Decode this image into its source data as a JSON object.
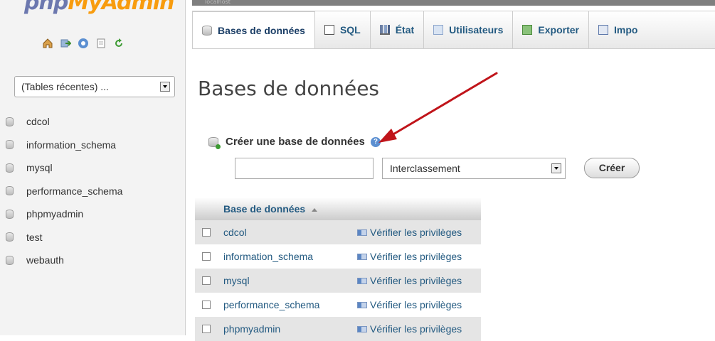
{
  "app": {
    "logo_part1": "php",
    "logo_part2": "MyAdmin"
  },
  "sidebar": {
    "quick_icons": [
      "home-icon",
      "exit-icon",
      "help-icon",
      "docs-icon",
      "reload-icon"
    ],
    "recent_tables_select": "(Tables récentes) ...",
    "databases": [
      "cdcol",
      "information_schema",
      "mysql",
      "performance_schema",
      "phpmyadmin",
      "test",
      "webauth"
    ]
  },
  "topbar": {
    "breadcrumb": "localhost"
  },
  "tabs": [
    {
      "label": "Bases de données",
      "icon": "database-icon",
      "active": true
    },
    {
      "label": "SQL",
      "icon": "sql-icon"
    },
    {
      "label": "État",
      "icon": "status-icon"
    },
    {
      "label": "Utilisateurs",
      "icon": "users-icon"
    },
    {
      "label": "Exporter",
      "icon": "export-icon"
    },
    {
      "label": "Impo",
      "icon": "import-icon"
    }
  ],
  "main": {
    "title": "Bases de données",
    "create_label": "Créer une base de données",
    "create_input_value": "",
    "collation_selected": "Interclassement",
    "create_button": "Créer",
    "table": {
      "header": "Base de données",
      "rows": [
        {
          "name": "cdcol",
          "action": "Vérifier les privilèges"
        },
        {
          "name": "information_schema",
          "action": "Vérifier les privilèges"
        },
        {
          "name": "mysql",
          "action": "Vérifier les privilèges"
        },
        {
          "name": "performance_schema",
          "action": "Vérifier les privilèges"
        },
        {
          "name": "phpmyadmin",
          "action": "Vérifier les privilèges"
        }
      ]
    }
  },
  "colors": {
    "link": "#235a81",
    "logo_blue": "#6c78af",
    "logo_orange": "#f89c0e",
    "arrow": "#c0141a"
  }
}
